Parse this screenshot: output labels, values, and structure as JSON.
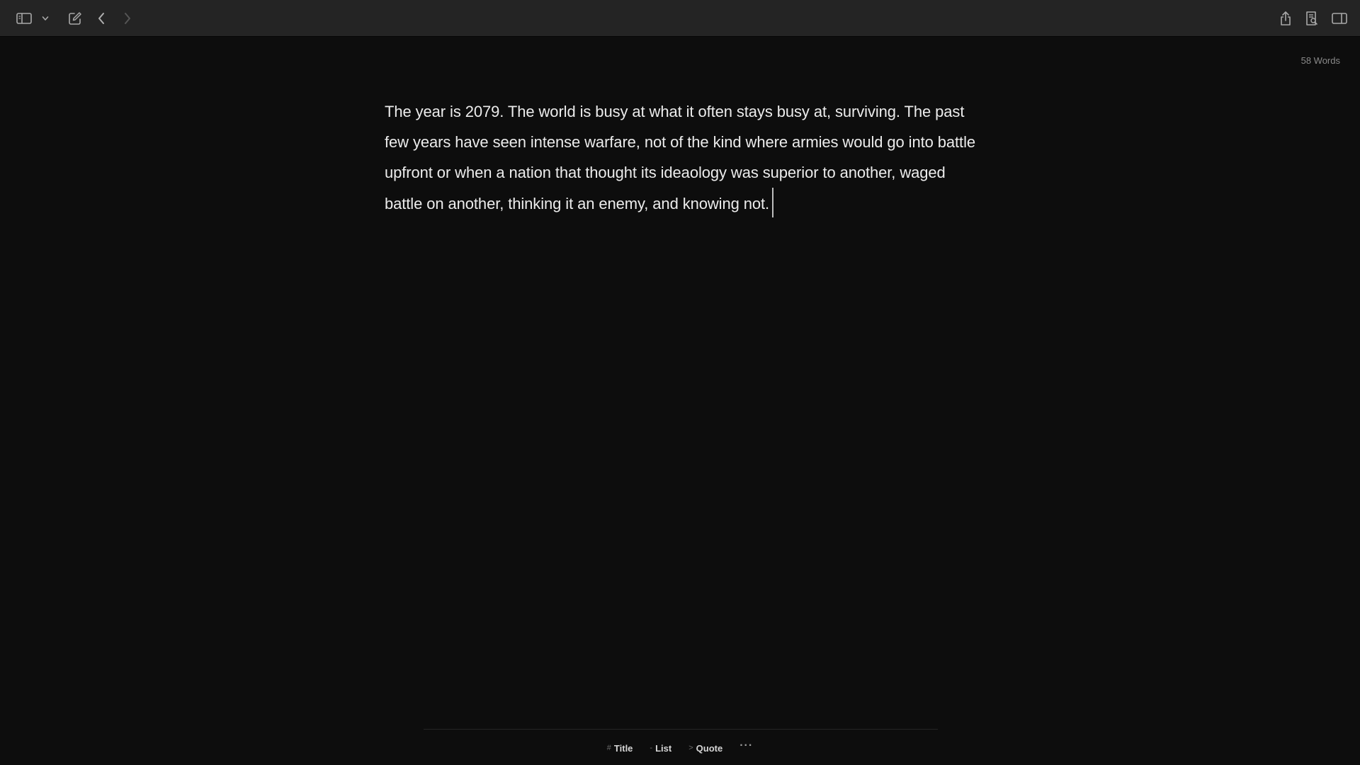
{
  "toolbar": {
    "left_icons": [
      "sidebar-toggle-icon",
      "chevron-down-icon",
      "compose-icon",
      "back-icon",
      "forward-icon"
    ],
    "right_icons": [
      "share-icon",
      "search-document-icon",
      "inspector-panel-icon"
    ]
  },
  "document": {
    "word_count": "58 Words",
    "body": "The year is 2079. The world is busy at what it often stays busy at, surviving. The past few years have seen intense warfare, not of the kind where armies would go into battle upfront or when a nation that thought its ideaology was superior to another, waged battle on another, thinking it an enemy, and knowing not."
  },
  "format_bar": {
    "title": {
      "prefix": "#",
      "label": "Title"
    },
    "list": {
      "prefix": "-",
      "label": "List"
    },
    "quote": {
      "prefix": ">",
      "label": "Quote"
    },
    "more": "···"
  },
  "colors": {
    "background": "#0d0d0d",
    "toolbar": "#242424",
    "text": "#ececec",
    "muted": "#8a8a8a"
  }
}
